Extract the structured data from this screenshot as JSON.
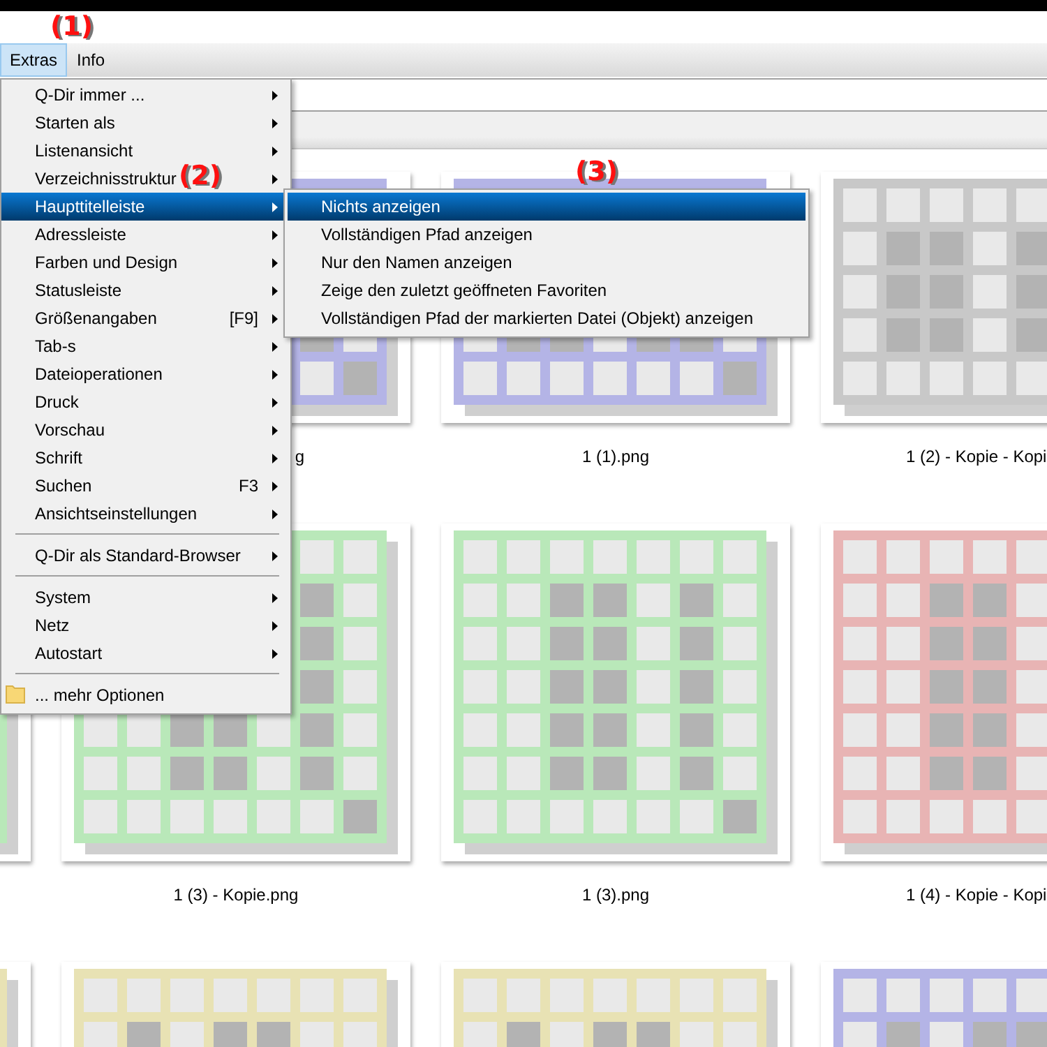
{
  "annotations": [
    {
      "text": "(1)"
    },
    {
      "text": "(2)"
    },
    {
      "text": "(3)"
    }
  ],
  "menubar": [
    {
      "label": "Extras",
      "selected": true
    },
    {
      "label": "Info",
      "selected": false
    }
  ],
  "menu": {
    "items": [
      {
        "kind": "item",
        "label": "Q-Dir immer ...",
        "submenu": true,
        "selected": false
      },
      {
        "kind": "item",
        "label": "Starten als",
        "submenu": true,
        "selected": false
      },
      {
        "kind": "item",
        "label": "Listenansicht",
        "submenu": true,
        "selected": false
      },
      {
        "kind": "item",
        "label": "Verzeichnisstruktur",
        "submenu": true,
        "selected": false
      },
      {
        "kind": "item",
        "label": "Haupttitelleiste",
        "submenu": true,
        "selected": true
      },
      {
        "kind": "item",
        "label": "Adressleiste",
        "submenu": true,
        "selected": false
      },
      {
        "kind": "item",
        "label": "Farben und Design",
        "submenu": true,
        "selected": false
      },
      {
        "kind": "item",
        "label": "Statusleiste",
        "submenu": true,
        "selected": false
      },
      {
        "kind": "item",
        "label": "Größenangaben",
        "shortcut": "[F9]",
        "submenu": true,
        "selected": false
      },
      {
        "kind": "item",
        "label": "Tab-s",
        "submenu": true,
        "selected": false
      },
      {
        "kind": "item",
        "label": "Dateioperationen",
        "submenu": true,
        "selected": false
      },
      {
        "kind": "item",
        "label": "Druck",
        "submenu": true,
        "selected": false
      },
      {
        "kind": "item",
        "label": "Vorschau",
        "submenu": true,
        "selected": false
      },
      {
        "kind": "item",
        "label": "Schrift",
        "submenu": true,
        "selected": false
      },
      {
        "kind": "item",
        "label": "Suchen",
        "shortcut": "F3",
        "submenu": true,
        "selected": false
      },
      {
        "kind": "item",
        "label": "Ansichtseinstellungen",
        "submenu": true,
        "selected": false
      },
      {
        "kind": "separator"
      },
      {
        "kind": "item",
        "label": "Q-Dir als Standard-Browser",
        "submenu": true,
        "selected": false
      },
      {
        "kind": "separator"
      },
      {
        "kind": "item",
        "label": "System",
        "submenu": true,
        "selected": false
      },
      {
        "kind": "item",
        "label": "Netz",
        "submenu": true,
        "selected": false
      },
      {
        "kind": "item",
        "label": "Autostart",
        "submenu": true,
        "selected": false
      },
      {
        "kind": "separator"
      },
      {
        "kind": "folder",
        "label": "... mehr Optionen",
        "submenu": false,
        "selected": false
      }
    ]
  },
  "submenu": {
    "items": [
      {
        "label": "Nichts anzeigen",
        "selected": true
      },
      {
        "label": "Vollständigen Pfad anzeigen",
        "selected": false
      },
      {
        "label": "Nur den Namen anzeigen",
        "selected": false
      },
      {
        "label": "Zeige den zuletzt geöffneten Favoriten",
        "selected": false
      },
      {
        "label": "Vollständigen Pfad der markierten Datei (Objekt) anzeigen",
        "selected": false
      }
    ]
  },
  "thumbnails": {
    "rows": [
      [
        null,
        {
          "kind": "covered",
          "color": "#b4b4e6",
          "label": "g"
        },
        {
          "kind": "file",
          "color": "#b4b4e6",
          "label": "1 (1).png"
        },
        {
          "kind": "file",
          "color": "#c8c8c8",
          "label": "1 (2) - Kopie - Kopi"
        }
      ],
      [
        {
          "kind": "file",
          "color": "#b9e8b9"
        },
        {
          "kind": "file",
          "color": "#b9e8b9",
          "label": "1 (3) - Kopie.png"
        },
        {
          "kind": "file",
          "color": "#b9e8b9",
          "label": "1 (3).png"
        },
        {
          "kind": "file",
          "color": "#e8b4b4",
          "label": "1 (4) - Kopie - Kopi"
        }
      ],
      [
        {
          "kind": "file",
          "color": "#e8e2b4"
        },
        {
          "kind": "file",
          "color": "#e8e2b4"
        },
        {
          "kind": "file",
          "color": "#e8e2b4"
        },
        {
          "kind": "file",
          "color": "#b4b4e6"
        }
      ]
    ]
  }
}
